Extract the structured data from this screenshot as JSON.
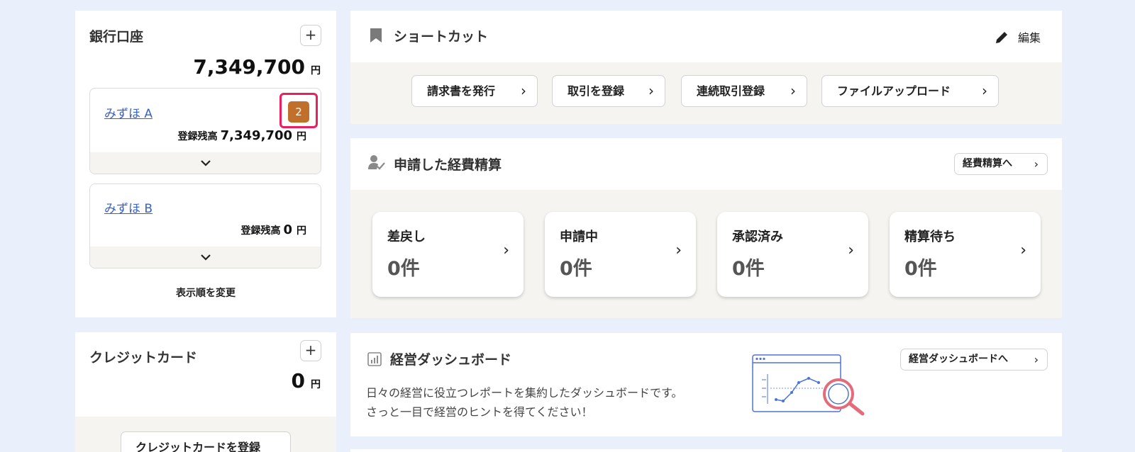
{
  "bank": {
    "title": "銀行口座",
    "add": "+",
    "total": "7,349,700",
    "unit": "円",
    "accounts": [
      {
        "name": "みずほ A",
        "balance_label": "登録残高",
        "balance": "7,349,700",
        "unit": "円",
        "badge": "2",
        "expand": "⌄"
      },
      {
        "name": "みずほ B",
        "balance_label": "登録残高",
        "balance": "0",
        "unit": "円",
        "expand": "⌄"
      }
    ],
    "reorder": "表示順を変更"
  },
  "credit": {
    "title": "クレジットカード",
    "add": "+",
    "total": "0",
    "unit": "円",
    "register": "クレジットカードを登録"
  },
  "shortcut": {
    "title": "ショートカット",
    "edit": "編集",
    "items": [
      {
        "label": "請求書を発行",
        "chev": "›"
      },
      {
        "label": "取引を登録",
        "chev": "›"
      },
      {
        "label": "連続取引登録",
        "chev": "›"
      },
      {
        "label": "ファイルアップロード",
        "chev": "›"
      }
    ]
  },
  "expense": {
    "title": "申請した経費精算",
    "link": "経費精算へ",
    "chev": "›",
    "statuses": [
      {
        "label": "差戻し",
        "count": "0件",
        "chev": "›"
      },
      {
        "label": "申請中",
        "count": "0件",
        "chev": "›"
      },
      {
        "label": "承認済み",
        "count": "0件",
        "chev": "›"
      },
      {
        "label": "精算待ち",
        "count": "0件",
        "chev": "›"
      }
    ]
  },
  "dashboard": {
    "title": "経営ダッシュボード",
    "link": "経営ダッシュボードへ",
    "chev": "›",
    "line1": "日々の経営に役立つレポートを集約したダッシュボードです。",
    "line2": "さっと一目で経営のヒントを得てください！"
  },
  "colors": {
    "background": "#e9f0fb",
    "link": "#3b61c9",
    "badge": "#c0702a",
    "highlight": "#e8205e",
    "band": "#f5f4f0"
  },
  "icons": {
    "bookmark": "bookmark-icon",
    "pencil": "pencil-icon",
    "user_check": "user-check-icon",
    "chart": "bar-chart-icon",
    "illustration": "dashboard-magnifier-illustration"
  }
}
